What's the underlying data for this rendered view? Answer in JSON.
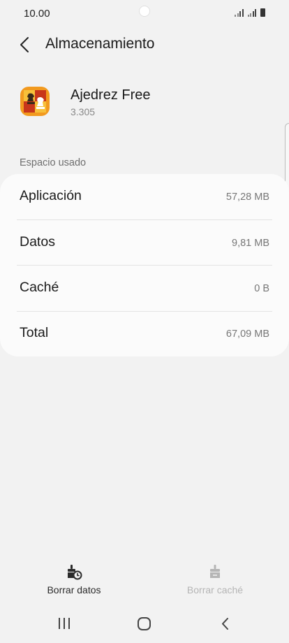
{
  "status_bar": {
    "time": "10.00"
  },
  "header": {
    "title": "Almacenamiento"
  },
  "app": {
    "name": "Ajedrez Free",
    "version": "3.305"
  },
  "section": {
    "label": "Espacio usado"
  },
  "storage": {
    "rows": [
      {
        "label": "Aplicación",
        "value": "57,28 MB"
      },
      {
        "label": "Datos",
        "value": "9,81 MB"
      },
      {
        "label": "Caché",
        "value": "0 B"
      },
      {
        "label": "Total",
        "value": "67,09 MB"
      }
    ]
  },
  "actions": {
    "clear_data": {
      "label": "Borrar datos",
      "enabled": true
    },
    "clear_cache": {
      "label": "Borrar caché",
      "enabled": false
    }
  },
  "colors": {
    "background": "#f2f2f2",
    "card": "#fbfbfb",
    "text": "#1a1a1a",
    "secondary": "#777777",
    "disabled": "#b5b5b5",
    "app_icon_orange": "#f29a1f",
    "app_icon_red": "#c8361b"
  },
  "icons": {
    "back": "chevron-left-icon",
    "clear_data": "broom-clock-icon",
    "clear_cache": "broom-icon",
    "nav_recents": "recents-icon",
    "nav_home": "home-icon",
    "nav_back": "back-icon"
  }
}
